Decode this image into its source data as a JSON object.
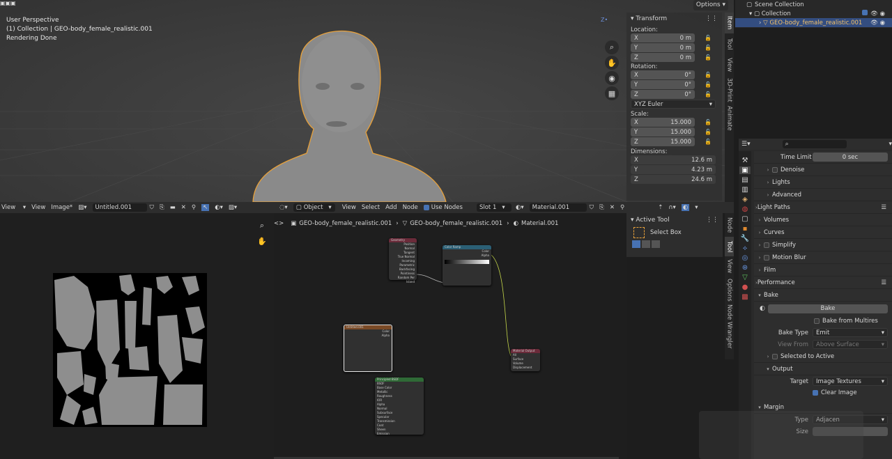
{
  "viewport": {
    "line1": "User Perspective",
    "line2": "(1) Collection | GEO-body_female_realistic.001",
    "line3": "Rendering Done",
    "options_label": "Options"
  },
  "side_tabs_top": [
    "Item",
    "Tool",
    "View",
    "3D-Print",
    "Animate"
  ],
  "transform": {
    "title": "Transform",
    "location_label": "Location:",
    "loc": [
      {
        "axis": "X",
        "val": "0 m"
      },
      {
        "axis": "Y",
        "val": "0 m"
      },
      {
        "axis": "Z",
        "val": "0 m"
      }
    ],
    "rotation_label": "Rotation:",
    "rot": [
      {
        "axis": "X",
        "val": "0°"
      },
      {
        "axis": "Y",
        "val": "0°"
      },
      {
        "axis": "Z",
        "val": "0°"
      }
    ],
    "rot_mode": "XYZ Euler",
    "scale_label": "Scale:",
    "scale": [
      {
        "axis": "X",
        "val": "15.000"
      },
      {
        "axis": "Y",
        "val": "15.000"
      },
      {
        "axis": "Z",
        "val": "15.000"
      }
    ],
    "dimensions_label": "Dimensions:",
    "dims": [
      {
        "axis": "X",
        "val": "12.6 m"
      },
      {
        "axis": "Y",
        "val": "4.23 m"
      },
      {
        "axis": "Z",
        "val": "24.6 m"
      }
    ]
  },
  "outliner": {
    "scene": "Scene Collection",
    "collection": "Collection",
    "object": "GEO-body_female_realistic.001"
  },
  "image_header": {
    "view": "View",
    "view2": "View",
    "image": "Image*",
    "name": "Untitled.001"
  },
  "node_header": {
    "mode": "Object",
    "view": "View",
    "select": "Select",
    "add": "Add",
    "node": "Node",
    "use_nodes": "Use Nodes",
    "slot": "Slot 1",
    "material": "Material.001"
  },
  "breadcrumb": [
    "GEO-body_female_realistic.001",
    "GEO-body_female_realistic.001",
    "Material.001"
  ],
  "active_tool": {
    "title": "Active Tool",
    "tool": "Select Box"
  },
  "side_tabs_node": [
    "Node",
    "Tool",
    "View",
    "Options",
    "Node Wrangler"
  ],
  "nodes": {
    "geometry": {
      "title": "Geometry",
      "rows": [
        "Position",
        "Normal",
        "Tangent",
        "True Normal",
        "Incoming",
        "Parametric",
        "Backfacing",
        "Pointiness",
        "Random Per Island"
      ]
    },
    "color_ramp": {
      "title": "Color Ramp",
      "rows": [
        "Color",
        "Alpha"
      ]
    },
    "image_texture": {
      "title": "Untitled.001",
      "rows": [
        "Color",
        "Alpha"
      ]
    },
    "material_output": {
      "title": "Material Output",
      "rows": [
        "All",
        "Surface",
        "Volume",
        "Displacement"
      ]
    },
    "bsdf": {
      "title": "Principled BSDF",
      "rows": [
        "BSDF",
        "Base Color",
        "Metallic",
        "Roughness",
        "IOR",
        "Alpha",
        "Normal",
        "Subsurface",
        "Specular",
        "Transmission",
        "Coat",
        "Sheen",
        "Emission"
      ]
    }
  },
  "props": {
    "time_limit_label": "Time Limit",
    "time_limit": "0 sec",
    "denoise": "Denoise",
    "lights": "Lights",
    "advanced": "Advanced",
    "light_paths": "Light Paths",
    "volumes": "Volumes",
    "curves": "Curves",
    "simplify": "Simplify",
    "motion_blur": "Motion Blur",
    "film": "Film",
    "performance": "Performance",
    "bake": "Bake",
    "bake_btn": "Bake",
    "bake_multires": "Bake from Multires",
    "bake_type_label": "Bake Type",
    "bake_type": "Emit",
    "view_from_label": "View From",
    "view_from": "Above Surface",
    "selected_active": "Selected to Active",
    "output": "Output",
    "target_label": "Target",
    "target": "Image Textures",
    "clear_image": "Clear Image",
    "margin": "Margin",
    "type_label": "Type",
    "type": "Adjacen",
    "size_label": "Size"
  }
}
